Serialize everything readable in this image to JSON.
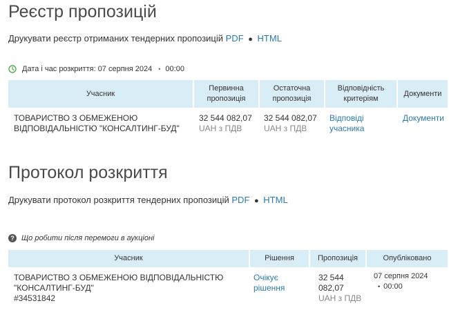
{
  "registry": {
    "title": "Реєстр пропозицій",
    "print_text": "Друкувати реєстр отриманих тендерних пропозицій",
    "pdf": "PDF",
    "html": "HTML",
    "date_label": "Дата і час розкриття: 07 серпня 2024",
    "date_time": "00:00",
    "columns": [
      "Учасник",
      "Первинна пропозиція",
      "Остаточна пропозиція",
      "Відповідність критеріям",
      "Документи"
    ],
    "row": {
      "participant": "ТОВАРИСТВО З ОБМЕЖЕНОЮ ВІДПОВІДАЛЬНІСТЮ \"КОНСАЛТИНГ-БУД\"",
      "initial_amount": "32 544 082,07",
      "initial_currency": "UAH з ПДВ",
      "final_amount": "32 544 082,07",
      "final_currency": "UAH з ПДВ",
      "compliance_link": "Відповіді учасника",
      "documents_link": "Документи"
    }
  },
  "protocol": {
    "title": "Протокол розкриття",
    "print_text": "Друкувати протокол розкриття тендерних пропозицій",
    "pdf": "PDF",
    "html": "HTML",
    "help_text": "Що робити після перемоги в аукціоні",
    "columns": [
      "Учасник",
      "Рішення",
      "Пропозиція",
      "Опубліковано"
    ],
    "row": {
      "participant": "ТОВАРИСТВО З ОБМЕЖЕНОЮ ВІДПОВІДАЛЬНІСТЮ \"КОНСАЛТИНГ-БУД\"",
      "participant_id": "#34531842",
      "decision_link": "Очікує рішення",
      "amount": "32 544 082,07",
      "currency": "UAH з ПДВ",
      "published_date": "07 серпня 2024",
      "published_time": "00:00"
    }
  },
  "colors": {
    "header_bg": "#d9edf7",
    "link": "#2a7ab0",
    "muted": "#888888"
  },
  "icons": [
    "clock-icon",
    "help-icon"
  ]
}
